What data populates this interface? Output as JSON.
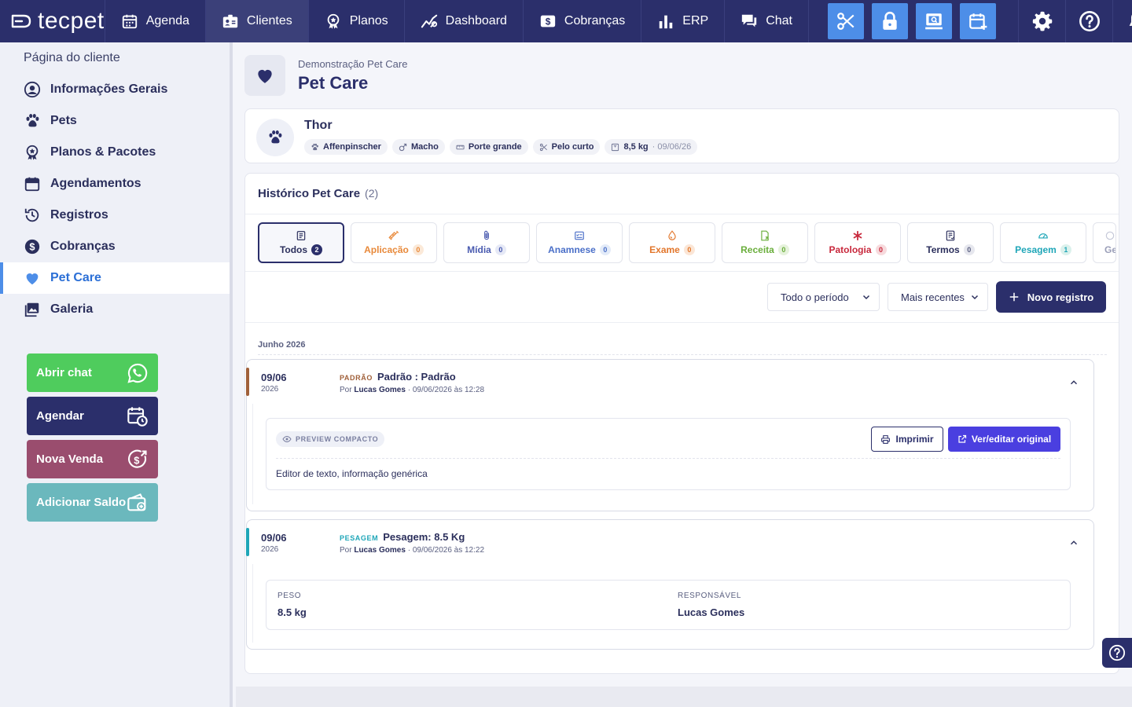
{
  "brand": {
    "name": "tecpet"
  },
  "nav": {
    "items": [
      {
        "label": "Agenda",
        "icon": "calendar-icon"
      },
      {
        "label": "Clientes",
        "icon": "clients-icon"
      },
      {
        "label": "Planos",
        "icon": "award-icon"
      },
      {
        "label": "Dashboard",
        "icon": "chart-line-icon"
      },
      {
        "label": "Cobranças",
        "icon": "dollar-icon"
      },
      {
        "label": "ERP",
        "icon": "bar-chart-icon"
      },
      {
        "label": "Chat",
        "icon": "chat-icon"
      }
    ],
    "active": "Clientes",
    "quick_actions": [
      "scissors-icon",
      "lock-icon",
      "pos-icon",
      "calendar-plus-icon"
    ],
    "right_icons": [
      "gear-icon",
      "help-icon",
      "bell-icon"
    ]
  },
  "sidebar": {
    "title": "Página do cliente",
    "items": [
      {
        "label": "Informações Gerais",
        "icon": "user-circle-icon"
      },
      {
        "label": "Pets",
        "icon": "paw-icon"
      },
      {
        "label": "Planos & Pacotes",
        "icon": "award-icon"
      },
      {
        "label": "Agendamentos",
        "icon": "calendar-icon"
      },
      {
        "label": "Registros",
        "icon": "history-icon"
      },
      {
        "label": "Cobranças",
        "icon": "dollar-circle-icon"
      },
      {
        "label": "Pet Care",
        "icon": "heart-icon"
      },
      {
        "label": "Galeria",
        "icon": "gallery-icon"
      }
    ],
    "active": "Pet Care",
    "actions": [
      {
        "label": "Abrir chat",
        "icon": "whatsapp-icon",
        "color": "#4fcc5d"
      },
      {
        "label": "Agendar",
        "icon": "calendar-clock-icon",
        "color": "#2b2f6b"
      },
      {
        "label": "Nova Venda",
        "icon": "sale-icon",
        "color": "#9a4d6e"
      },
      {
        "label": "Adicionar Saldo",
        "icon": "wallet-icon",
        "color": "#6bb8bd"
      }
    ]
  },
  "page": {
    "subtitle": "Demonstração Pet Care",
    "title": "Pet Care"
  },
  "pet": {
    "name": "Thor",
    "tags": [
      {
        "label": "Affenpinscher",
        "icon": "paw-icon"
      },
      {
        "label": "Macho",
        "icon": "male-icon"
      },
      {
        "label": "Porte grande",
        "icon": "ruler-icon"
      },
      {
        "label": "Pelo curto",
        "icon": "scissors-icon"
      },
      {
        "label": "8,5 kg",
        "icon": "scale-icon",
        "extra": "· 09/06/26"
      }
    ]
  },
  "history": {
    "title": "Histórico Pet Care",
    "count": "(2)",
    "filters": [
      {
        "label": "Todos",
        "count": "2",
        "color": "#2b2f5c",
        "icon": "list-icon",
        "active": true
      },
      {
        "label": "Aplicação",
        "count": "0",
        "color": "#e8893a",
        "icon": "syringe-icon"
      },
      {
        "label": "Mídia",
        "count": "0",
        "color": "#4a5bb0",
        "icon": "paperclip-icon"
      },
      {
        "label": "Anamnese",
        "count": "0",
        "color": "#4a6fc8",
        "icon": "form-icon"
      },
      {
        "label": "Exame",
        "count": "0",
        "color": "#e2762b",
        "icon": "flask-icon"
      },
      {
        "label": "Receita",
        "count": "0",
        "color": "#6aae3c",
        "icon": "prescription-icon"
      },
      {
        "label": "Patologia",
        "count": "0",
        "color": "#c8283c",
        "icon": "asterisk-icon"
      },
      {
        "label": "Termos",
        "count": "0",
        "color": "#2b2f5c",
        "icon": "document-icon"
      },
      {
        "label": "Pesagem",
        "count": "1",
        "color": "#1fa6b8",
        "icon": "gauge-icon"
      },
      {
        "label": "Ge",
        "count": "",
        "color": "#9a9eb8",
        "icon": "more-icon"
      }
    ],
    "period_select": "Todo o período",
    "sort_select": "Mais recentes",
    "new_button": "Novo registro",
    "month": "Junho 2026",
    "entries": [
      {
        "date": "09/06",
        "year": "2026",
        "type": "PADRÃO",
        "type_color": "#a0603a",
        "title": "Padrão : Padrão",
        "meta_prefix": "Por",
        "author": "Lucas Gomes",
        "meta_suffix": "· 09/06/2026 às 12:28",
        "preview_label": "PREVIEW COMPACTO",
        "print_label": "Imprimir",
        "edit_label": "Ver/editar original",
        "content": "Editor de texto, informação genérica"
      },
      {
        "date": "09/06",
        "year": "2026",
        "type": "PESAGEM",
        "type_color": "#1fa6b8",
        "title": "Pesagem: 8.5 Kg",
        "meta_prefix": "Por",
        "author": "Lucas Gomes",
        "meta_suffix": "· 09/06/2026 às 12:22",
        "fields": [
          {
            "label": "PESO",
            "value": "8.5 kg"
          },
          {
            "label": "RESPONSÁVEL",
            "value": "Lucas Gomes"
          }
        ]
      }
    ]
  }
}
